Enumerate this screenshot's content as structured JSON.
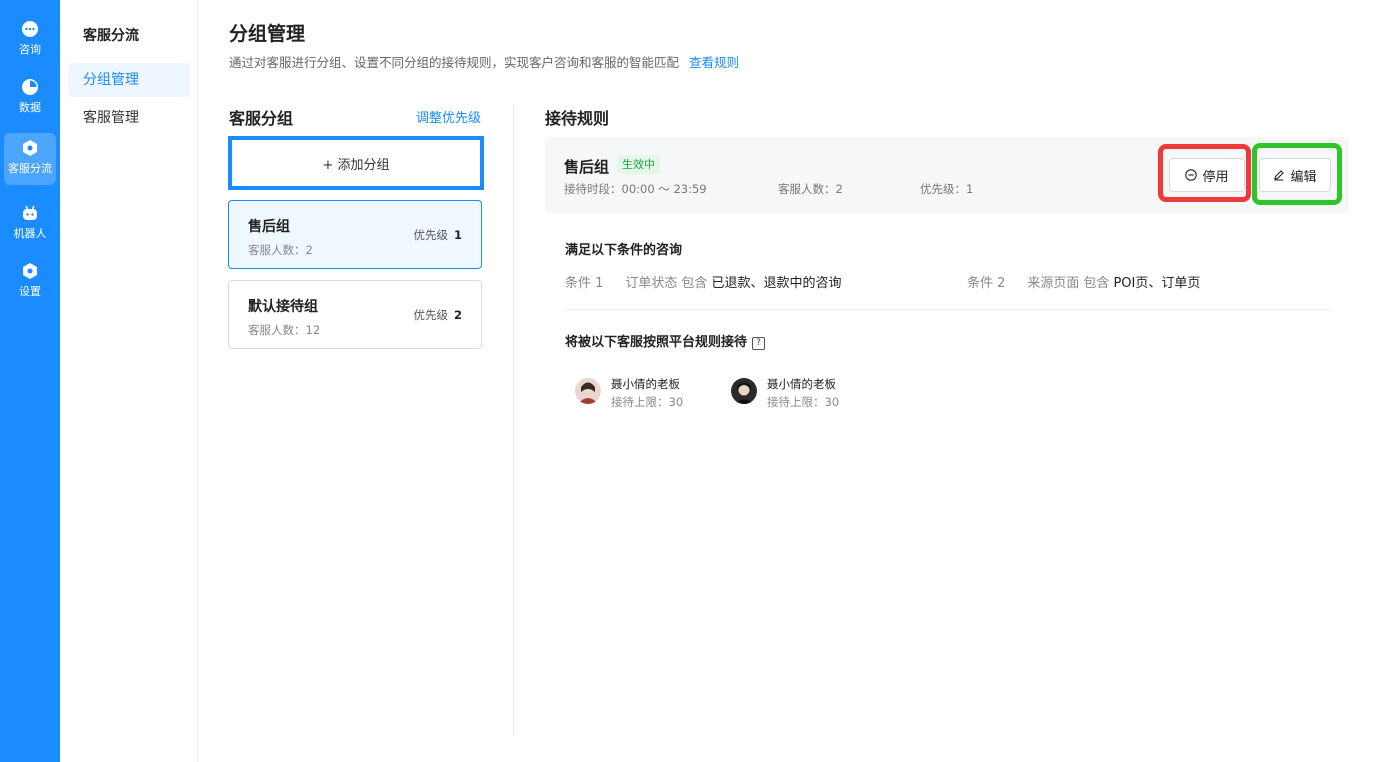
{
  "rail": {
    "items": [
      {
        "label": "咨询",
        "icon": "chat-bubble-icon"
      },
      {
        "label": "数据",
        "icon": "pie-chart-icon"
      },
      {
        "label": "客服分流",
        "icon": "hexagon-icon"
      },
      {
        "label": "机器人",
        "icon": "robot-icon"
      },
      {
        "label": "设置",
        "icon": "settings-hexagon-icon"
      }
    ]
  },
  "subnav": {
    "title": "客服分流",
    "items": [
      {
        "label": "分组管理"
      },
      {
        "label": "客服管理"
      }
    ]
  },
  "header": {
    "title": "分组管理",
    "description": "通过对客服进行分组、设置不同分组的接待规则，实现客户咨询和客服的智能匹配",
    "rules_link": "查看规则"
  },
  "groups": {
    "title": "客服分组",
    "adjust_priority": "调整优先级",
    "add_button": "+ 添加分组",
    "items": [
      {
        "name": "售后组",
        "count": "客服人数：2",
        "priority_label": "优先级",
        "priority": "1"
      },
      {
        "name": "默认接待组",
        "count": "客服人数：12",
        "priority_label": "优先级",
        "priority": "2"
      }
    ]
  },
  "rule": {
    "title": "接待规则",
    "group_name": "售后组",
    "status": "生效中",
    "hours": "接待时段：00:00 ～ 23:59",
    "agent_count": "客服人数：2",
    "priority": "优先级：1",
    "disable_label": "停用",
    "edit_label": "编辑",
    "conditions_title": "满足以下条件的咨询",
    "conditions": [
      {
        "label": "条件 1",
        "field": "订单状态",
        "op": "包含",
        "value": "已退款、退款中的咨询"
      },
      {
        "label": "条件 2",
        "field": "来源页面",
        "op": "包含",
        "value": "POI页、订单页"
      }
    ],
    "agents_title": "将被以下客服按照平台规则接待",
    "help_icon": "?",
    "agents": [
      {
        "name": "聂小倩的老板",
        "limit": "接待上限：30"
      },
      {
        "name": "聂小倩的老板",
        "limit": "接待上限：30"
      }
    ]
  },
  "colors": {
    "primary": "#1a8cff",
    "success": "#1aa34a",
    "highlight_red": "#f0393b",
    "highlight_green": "#2fc52a"
  }
}
